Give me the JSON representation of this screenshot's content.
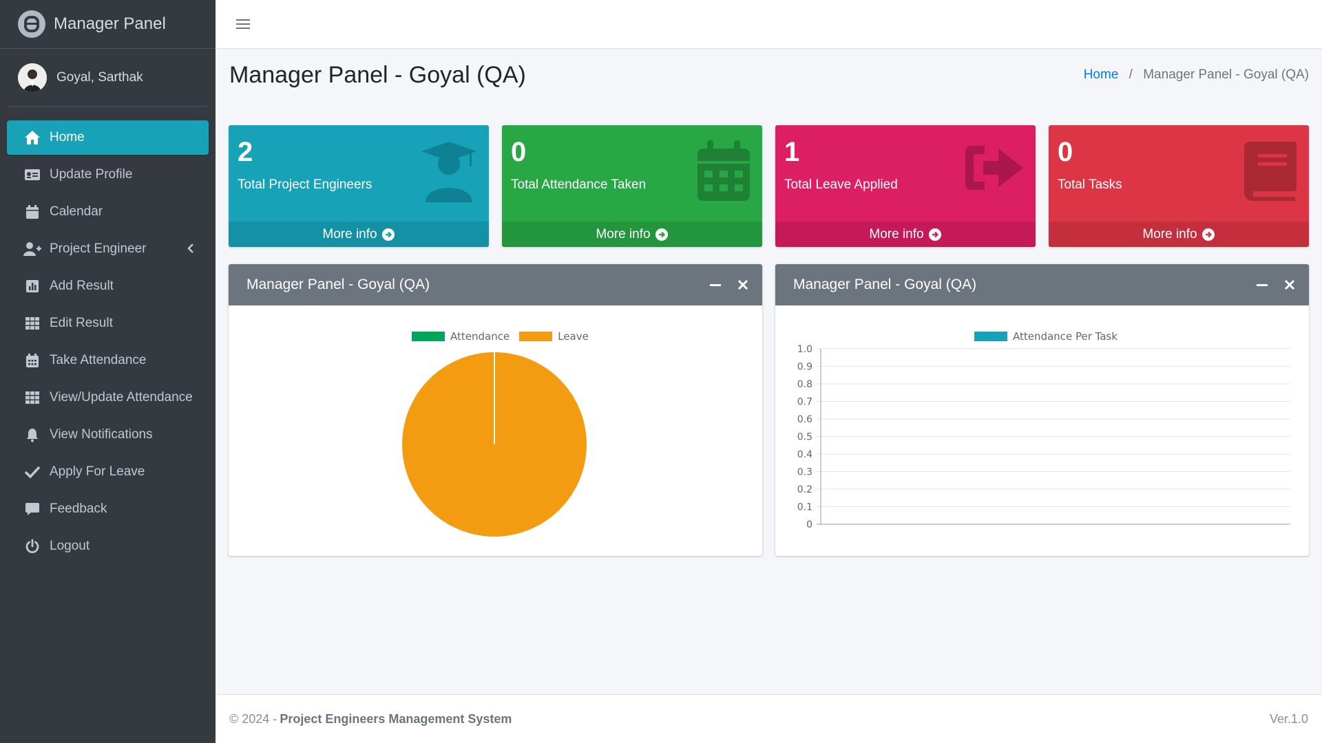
{
  "brand": {
    "title": "Manager Panel"
  },
  "user": {
    "name": "Goyal, Sarthak"
  },
  "sidebar": {
    "items": [
      {
        "label": "Home",
        "icon": "home-icon",
        "active": true
      },
      {
        "label": "Update Profile",
        "icon": "id-card-icon"
      },
      {
        "label": "Calendar",
        "icon": "calendar-icon"
      },
      {
        "label": "Project Engineer",
        "icon": "user-plus-icon",
        "has_submenu": true
      },
      {
        "label": "Add Result",
        "icon": "chart-icon"
      },
      {
        "label": "Edit Result",
        "icon": "grid-icon"
      },
      {
        "label": "Take Attendance",
        "icon": "calendar-grid-icon"
      },
      {
        "label": "View/Update Attendance",
        "icon": "grid-icon"
      },
      {
        "label": "View Notifications",
        "icon": "bell-icon"
      },
      {
        "label": "Apply For Leave",
        "icon": "check-icon"
      },
      {
        "label": "Feedback",
        "icon": "comment-icon"
      },
      {
        "label": "Logout",
        "icon": "power-icon"
      }
    ]
  },
  "header": {
    "page_title": "Manager Panel - Goyal (QA)",
    "breadcrumb_home": "Home",
    "breadcrumb_sep": "/",
    "breadcrumb_current": "Manager Panel - Goyal (QA)"
  },
  "stats": [
    {
      "value": "2",
      "label": "Total Project Engineers",
      "more": "More info",
      "color": "#17a2b8",
      "icon": "graduate-icon"
    },
    {
      "value": "0",
      "label": "Total Attendance Taken",
      "more": "More info",
      "color": "#28a745",
      "icon": "calendar-icon"
    },
    {
      "value": "1",
      "label": "Total Leave Applied",
      "more": "More info",
      "color": "#dc1e63",
      "icon": "sign-out-icon"
    },
    {
      "value": "0",
      "label": "Total Tasks",
      "more": "More info",
      "color": "#dc3545",
      "icon": "book-icon"
    }
  ],
  "cards": [
    {
      "title": "Manager Panel - Goyal (QA)"
    },
    {
      "title": "Manager Panel - Goyal (QA)"
    }
  ],
  "chart_data": [
    {
      "type": "pie",
      "labels": [
        "Attendance",
        "Leave"
      ],
      "values": [
        0,
        1
      ],
      "colors": [
        "#00a65a",
        "#f39c12"
      ],
      "legend": "top"
    },
    {
      "type": "bar",
      "series": [
        {
          "name": "Attendance Per Task",
          "values": []
        }
      ],
      "categories": [],
      "ylim": [
        0,
        1.0
      ],
      "yticks": [
        "1.0",
        "0.9",
        "0.8",
        "0.7",
        "0.6",
        "0.5",
        "0.4",
        "0.3",
        "0.2",
        "0.1",
        "0"
      ],
      "color": "#17a2b8",
      "legend": "top",
      "grid": true
    }
  ],
  "footer": {
    "copyright": "© 2024 -",
    "system_name": "Project Engineers Management System",
    "version": "Ver.1.0"
  }
}
